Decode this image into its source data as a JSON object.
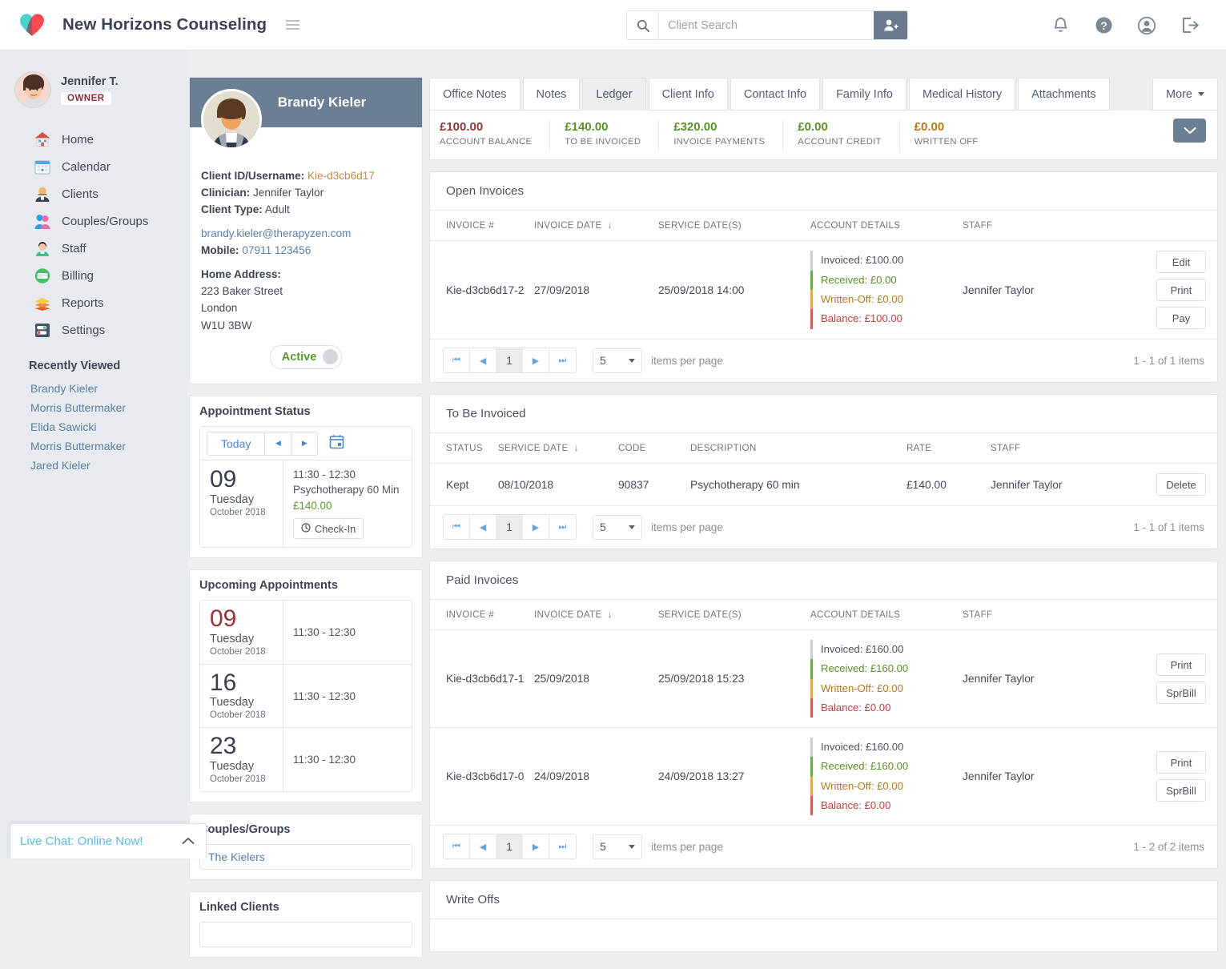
{
  "header": {
    "app_title": "New Horizons Counseling",
    "logo_icon": "heart-logo",
    "menu_icon": "hamburger-icon",
    "search": {
      "placeholder": "Client Search",
      "value": "",
      "icon": "search-icon",
      "add_icon": "add-client-icon"
    },
    "icons": [
      {
        "name": "notifications-icon",
        "glyph": "bell"
      },
      {
        "name": "help-icon",
        "glyph": "question-circle"
      },
      {
        "name": "account-icon",
        "glyph": "user-circle"
      },
      {
        "name": "logout-icon",
        "glyph": "sign-out"
      }
    ]
  },
  "sidebar": {
    "user": {
      "name": "Jennifer T.",
      "role_badge": "OWNER",
      "avatar": "user-avatar"
    },
    "items": [
      {
        "label": "Home",
        "icon": "home-icon"
      },
      {
        "label": "Calendar",
        "icon": "calendar-icon"
      },
      {
        "label": "Clients",
        "icon": "clients-icon"
      },
      {
        "label": "Couples/Groups",
        "icon": "couples-groups-icon"
      },
      {
        "label": "Staff",
        "icon": "staff-icon"
      },
      {
        "label": "Billing",
        "icon": "billing-icon"
      },
      {
        "label": "Reports",
        "icon": "reports-icon"
      },
      {
        "label": "Settings",
        "icon": "settings-icon"
      }
    ],
    "recently_viewed_title": "Recently Viewed",
    "recently_viewed": [
      "Brandy Kieler",
      "Morris Buttermaker",
      "Elida Sawicki",
      "Morris Buttermaker",
      "Jared Kieler"
    ]
  },
  "live_chat": {
    "label": "Live Chat: Online Now!",
    "toggle_icon": "chevron-up-icon"
  },
  "client": {
    "name": "Brandy Kieler",
    "photo": "client-photo",
    "id_label": "Client ID/Username:",
    "id_value": "Kie-d3cb6d17",
    "clinician_label": "Clinician:",
    "clinician_value": "Jennifer Taylor",
    "type_label": "Client Type:",
    "type_value": "Adult",
    "email": "brandy.kieler@therapyzen.com",
    "mobile_label": "Mobile:",
    "mobile_value": "07911 123456",
    "address_label": "Home Address:",
    "address_lines": [
      "223 Baker Street",
      "London",
      "W1U 3BW"
    ],
    "status_toggle": "Active"
  },
  "appointment_status": {
    "title": "Appointment Status",
    "today_label": "Today",
    "prev_icon": "arrow-left-icon",
    "next_icon": "arrow-right-icon",
    "calendar_icon": "calendar-picker-icon",
    "day": "09",
    "weekday": "Tuesday",
    "month_year": "October 2018",
    "time": "11:30 - 12:30",
    "service": "Psychotherapy 60 Min",
    "price": "£140.00",
    "checkin_label": "Check-In",
    "checkin_icon": "clock-icon"
  },
  "upcoming": {
    "title": "Upcoming Appointments",
    "rows": [
      {
        "day": "09",
        "weekday": "Tuesday",
        "month_year": "October 2018",
        "time": "11:30 - 12:30",
        "today": true
      },
      {
        "day": "16",
        "weekday": "Tuesday",
        "month_year": "October 2018",
        "time": "11:30 - 12:30",
        "today": false
      },
      {
        "day": "23",
        "weekday": "Tuesday",
        "month_year": "October 2018",
        "time": "11:30 - 12:30",
        "today": false
      }
    ]
  },
  "couples_groups": {
    "title": "Couples/Groups",
    "value": "The Kielers"
  },
  "linked_clients": {
    "title": "Linked Clients"
  },
  "tabs": {
    "items": [
      "Office Notes",
      "Notes",
      "Ledger",
      "Client Info",
      "Contact Info",
      "Family Info",
      "Medical History",
      "Attachments"
    ],
    "active": "Ledger",
    "more_label": "More"
  },
  "stats": {
    "items": [
      {
        "value": "£100.00",
        "label": "ACCOUNT BALANCE",
        "color": "red"
      },
      {
        "value": "£140.00",
        "label": "TO BE INVOICED",
        "color": "green"
      },
      {
        "value": "£320.00",
        "label": "INVOICE PAYMENTS",
        "color": "green"
      },
      {
        "value": "£0.00",
        "label": "ACCOUNT CREDIT",
        "color": "green"
      },
      {
        "value": "£0.00",
        "label": "WRITTEN OFF",
        "color": "orange"
      }
    ],
    "collapse_icon": "chevron-down-icon"
  },
  "open_invoices": {
    "title": "Open Invoices",
    "columns": [
      "INVOICE #",
      "INVOICE DATE",
      "SERVICE DATE(S)",
      "ACCOUNT DETAILS",
      "STAFF"
    ],
    "sorted_column": "INVOICE DATE",
    "rows": [
      {
        "invoice": "Kie-d3cb6d17-2",
        "invoice_date": "27/09/2018",
        "service_dates": "25/09/2018 14:00",
        "details": {
          "invoiced": "Invoiced: £100.00",
          "received": "Received: £0.00",
          "written_off": "Written-Off: £0.00",
          "balance": "Balance: £100.00"
        },
        "staff": "Jennifer Taylor",
        "actions": [
          "Edit",
          "Print",
          "Pay"
        ]
      }
    ],
    "pager": {
      "page": "1",
      "items_per_page": "5",
      "items_per_page_label": "items per page",
      "count": "1 - 1 of 1 items"
    }
  },
  "to_be_invoiced": {
    "title": "To Be Invoiced",
    "columns": [
      "STATUS",
      "SERVICE DATE",
      "CODE",
      "DESCRIPTION",
      "RATE",
      "STAFF"
    ],
    "sorted_column": "SERVICE DATE",
    "rows": [
      {
        "status": "Kept",
        "service_date": "08/10/2018",
        "code": "90837",
        "description": "Psychotherapy 60 min",
        "rate": "£140.00",
        "staff": "Jennifer Taylor",
        "action": "Delete"
      }
    ],
    "pager": {
      "page": "1",
      "items_per_page": "5",
      "items_per_page_label": "items per page",
      "count": "1 - 1 of 1 items"
    }
  },
  "paid_invoices": {
    "title": "Paid Invoices",
    "columns": [
      "INVOICE #",
      "INVOICE DATE",
      "SERVICE DATE(S)",
      "ACCOUNT DETAILS",
      "STAFF"
    ],
    "sorted_column": "INVOICE DATE",
    "rows": [
      {
        "invoice": "Kie-d3cb6d17-1",
        "invoice_date": "25/09/2018",
        "service_dates": "25/09/2018 15:23",
        "details": {
          "invoiced": "Invoiced: £160.00",
          "received": "Received: £160.00",
          "written_off": "Written-Off: £0.00",
          "balance": "Balance: £0.00"
        },
        "staff": "Jennifer Taylor",
        "actions": [
          "Print",
          "SprBill"
        ]
      },
      {
        "invoice": "Kie-d3cb6d17-0",
        "invoice_date": "24/09/2018",
        "service_dates": "24/09/2018 13:27",
        "details": {
          "invoiced": "Invoiced: £160.00",
          "received": "Received: £160.00",
          "written_off": "Written-Off: £0.00",
          "balance": "Balance: £0.00"
        },
        "staff": "Jennifer Taylor",
        "actions": [
          "Print",
          "SprBill"
        ]
      }
    ],
    "pager": {
      "page": "1",
      "items_per_page": "5",
      "items_per_page_label": "items per page",
      "count": "1 - 2 of 2 items"
    }
  },
  "write_offs": {
    "title": "Write Offs"
  },
  "pager_icons": {
    "first": "first-page-icon",
    "prev": "prev-page-icon",
    "next": "next-page-icon",
    "last": "last-page-icon"
  }
}
